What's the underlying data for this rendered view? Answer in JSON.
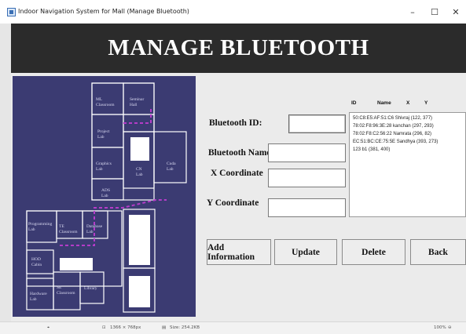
{
  "window": {
    "title": "Indoor Navigation System for Mall (Manage Bluetooth)",
    "minimize": "–",
    "maximize": "☐",
    "close": "✕"
  },
  "header": {
    "title": "MANAGE BLUETOOTH"
  },
  "map": {
    "rooms": {
      "ml_classroom": [
        "ML",
        "Classroom"
      ],
      "seminar_hall": [
        "Seminar",
        "Hall"
      ],
      "project_lab": [
        "Project",
        "Lab"
      ],
      "graphics_lab": [
        "Graphics",
        "Lab"
      ],
      "cn_lab": [
        "CN",
        "Lab"
      ],
      "cuda_lab": [
        "Cuda",
        "Lab"
      ],
      "ads_lab": [
        "ADS",
        "Lab"
      ],
      "programming_lab": [
        "Programming",
        "Lab"
      ],
      "te_classroom": [
        "TE",
        "Classroom"
      ],
      "database_lab": [
        "Database",
        "Lab"
      ],
      "hod_cabin": [
        "HOD",
        "Cabin"
      ],
      "se_classroom": [
        "SE",
        "Classroom"
      ],
      "library": [
        "Library"
      ],
      "hardware_lab": [
        "Hardware",
        "Lab"
      ]
    }
  },
  "form": {
    "bluetooth_id_label": "Bluetooth ID:",
    "bluetooth_name_label": "Bluetooth Name:",
    "x_label": "X Coordinate",
    "y_label": "Y Coordinate",
    "bluetooth_id_value": "",
    "bluetooth_name_value": "",
    "x_value": "",
    "y_value": ""
  },
  "list": {
    "headers": [
      "ID",
      "Name",
      "X",
      "Y"
    ],
    "rows": [
      "50:C8:E5:AF:51:C6 Shivraj (122, 377)",
      "78:02:F8:96:3E:28 kanchan (297, 293)",
      "78:02:F8:C2:56:22 Namrata (296, 82)",
      "EC:51:BC:CE:75:5E Sandhya (393, 273)",
      "123 b1 (381, 400)"
    ]
  },
  "buttons": {
    "add": "Add Information",
    "update": "Update",
    "delete": "Delete",
    "back": "Back"
  },
  "statusbar": {
    "dimensions": "1366 × 768px",
    "size": "Size: 254.2KB",
    "zoom": "100%"
  },
  "colors": {
    "header_bg": "#2b2b2b",
    "map_bg": "#3b3b72",
    "map_lines": "#ffffff",
    "map_path": "#b43cc8"
  }
}
